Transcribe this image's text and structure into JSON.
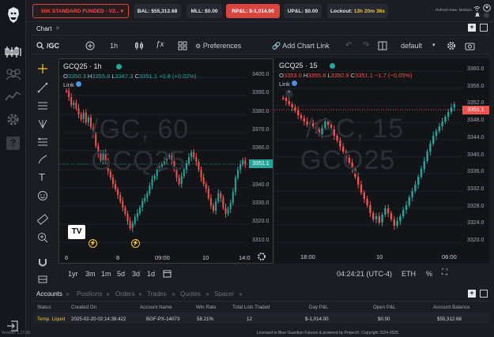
{
  "topbar": {
    "account_select": "50K STANDARD FUNDED - V2...",
    "bal": "BAL: $55,312.68",
    "mll": "MLL: $0.00",
    "rpl": "RP&L: $-1,014.00",
    "upl": "UP&L: $0.00",
    "lockout_label": "Lockout:",
    "lockout_value": "13h 20m 36s",
    "refresh_rate": "Refresh Rate: Medium"
  },
  "chart_tab": "Chart",
  "toolbar": {
    "symbol": "/GC",
    "interval": "1h",
    "preferences": "Preferences",
    "add_chart_link": "Add Chart Link",
    "layout": "default"
  },
  "left_chart": {
    "symbol": "GCQ25 · 1h",
    "o_label": "O",
    "o": "3350.3",
    "h_label": "H",
    "h": "3355.8",
    "l_label": "L",
    "l": "3347.3",
    "c_label": "C",
    "c": "3351.1",
    "change": "+0.8 (+0.02%)",
    "link": "Link",
    "watermark_1": "/GC, 60",
    "watermark_2": "GCQ25",
    "price_ticks": [
      "3400.0",
      "3390.0",
      "3380.0",
      "3370.0",
      "3360.0",
      "3350.0",
      "3340.0",
      "3330.0",
      "3320.0",
      "3310.0"
    ],
    "current_price": "3351.1",
    "time_ticks": [
      "6",
      "8",
      "09:00",
      "10",
      "14:0"
    ]
  },
  "right_chart": {
    "symbol": "GCQ25 · 15",
    "o_label": "O",
    "o": "3353.0",
    "h_label": "H",
    "h": "3355.8",
    "l_label": "L",
    "l": "3350.9",
    "c_label": "C",
    "c": "3351.1",
    "change": "−1.7 (−0.05%)",
    "link": "Link",
    "watermark_1": "/GC, 15",
    "watermark_2": "GCQ25",
    "price_ticks": [
      "3360.0",
      "3356.0",
      "3352.0",
      "3348.0",
      "3344.0",
      "3340.0",
      "3336.0",
      "3332.0",
      "3328.0",
      "3324.0",
      "3320.0"
    ],
    "current_price": "3351.1",
    "time_ticks": [
      "18:00",
      "10",
      "06:00"
    ]
  },
  "timeframes": [
    "1yr",
    "3m",
    "1m",
    "5d",
    "3d",
    "1d"
  ],
  "clock": "04:24:21 (UTC-4)",
  "eth": "ETH",
  "percent": "%",
  "bottom_tabs": [
    "Accounts",
    "Positions",
    "Orders",
    "Trades",
    "Quotes",
    "Spacer"
  ],
  "table": {
    "headers": [
      "Status",
      "Created On",
      "Account Name",
      "Win Rate",
      "Total Lots Traded",
      "Day P&L",
      "Open P&L",
      "Account Balance"
    ],
    "row": [
      "Temp. Liquid",
      "2025-02-20 02:14:38.422",
      "BGF-PX-14073",
      "58.21%",
      "12",
      "$-1,014.00",
      "$0.00",
      "$55,312.68"
    ]
  },
  "footer": {
    "version": "Version: 1.17.15",
    "license": "Licensed to Blue Guardian Futures & powered by ProjectX. Copyright 2024-2025"
  },
  "colors": {
    "up": "#26a69a",
    "down": "#ef5350",
    "accent": "#d8443e"
  }
}
